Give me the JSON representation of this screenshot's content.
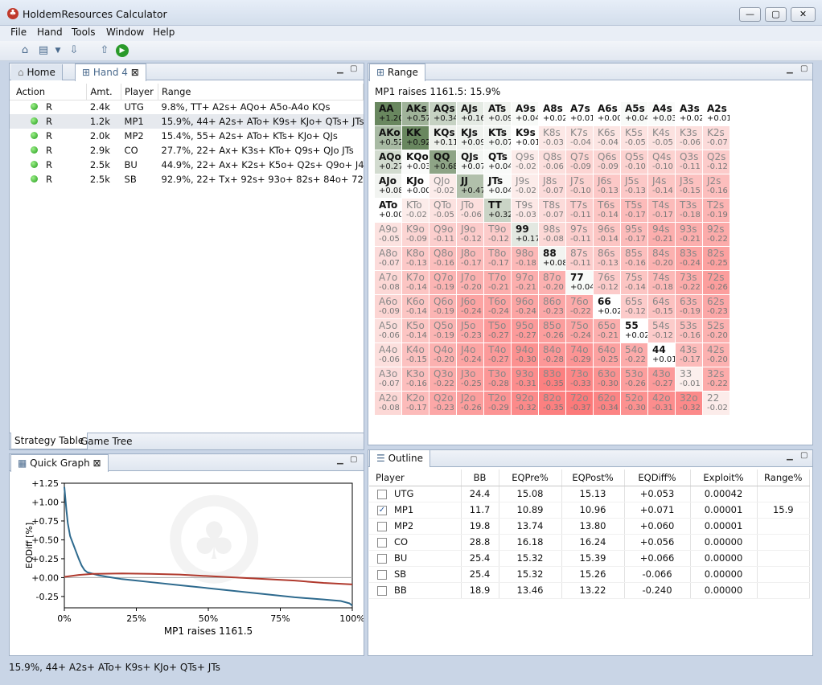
{
  "app": {
    "title": "HoldemResources Calculator",
    "min": "—",
    "max": "▢",
    "close": "✕"
  },
  "menu": [
    "File",
    "Hand",
    "Tools",
    "Window",
    "Help"
  ],
  "tabs": {
    "home": "Home",
    "hand": "Hand 4",
    "close": "⊠"
  },
  "strategy": {
    "headers": [
      "Action",
      "Amt.",
      "Player",
      "Range"
    ],
    "rows": [
      {
        "action": "R",
        "amt": "2.4k",
        "player": "UTG",
        "range": "9.8%, TT+ A2s+ AQo+ A5o-A4o KQs"
      },
      {
        "action": "R",
        "amt": "1.2k",
        "player": "MP1",
        "range": "15.9%, 44+ A2s+ ATo+ K9s+ KJo+ QTs+ JTs"
      },
      {
        "action": "R",
        "amt": "2.0k",
        "player": "MP2",
        "range": "15.4%, 55+ A2s+ ATo+ KTs+ KJo+ QJs"
      },
      {
        "action": "R",
        "amt": "2.9k",
        "player": "CO",
        "range": "27.7%, 22+ Ax+ K3s+ KTo+ Q9s+ QJo JTs"
      },
      {
        "action": "R",
        "amt": "2.5k",
        "player": "BU",
        "range": "44.9%, 22+ Ax+ K2s+ K5o+ Q2s+ Q9o+ J4s+ J9"
      },
      {
        "action": "R",
        "amt": "2.5k",
        "player": "SB",
        "range": "92.9%, 22+ Tx+ 92s+ 93o+ 82s+ 84o+ 72s+ 73o"
      }
    ],
    "bottom_tabs": [
      "Strategy Table",
      "Game Tree"
    ]
  },
  "quick_graph": {
    "tab": "Quick Graph",
    "close": "⊠"
  },
  "chart_data": {
    "type": "line",
    "xlabel": "MP1 raises 1161.5",
    "ylabel": "EQDiff [%]",
    "ylim": [
      -0.4,
      1.25
    ],
    "xlim": [
      0,
      100
    ],
    "yticks": [
      "+1.25",
      "+1.00",
      "+0.75",
      "+0.50",
      "+0.25",
      "+0.00",
      "-0.25"
    ],
    "yvals": [
      1.25,
      1.0,
      0.75,
      0.5,
      0.25,
      0.0,
      -0.25
    ],
    "xticks": [
      "0%",
      "25%",
      "50%",
      "75%",
      "100%"
    ],
    "xvals": [
      0,
      25,
      50,
      75,
      100
    ],
    "series": [
      {
        "color": "#2e6a8e",
        "points": [
          [
            0,
            1.2
          ],
          [
            0.7,
            0.9
          ],
          [
            1.2,
            0.72
          ],
          [
            2,
            0.55
          ],
          [
            3,
            0.45
          ],
          [
            4,
            0.35
          ],
          [
            5,
            0.25
          ],
          [
            6,
            0.16
          ],
          [
            7,
            0.1
          ],
          [
            8,
            0.07
          ],
          [
            10,
            0.05
          ],
          [
            12,
            0.03
          ],
          [
            15,
            0.01
          ],
          [
            20,
            -0.02
          ],
          [
            25,
            -0.04
          ],
          [
            30,
            -0.06
          ],
          [
            40,
            -0.1
          ],
          [
            50,
            -0.14
          ],
          [
            60,
            -0.18
          ],
          [
            70,
            -0.22
          ],
          [
            80,
            -0.26
          ],
          [
            90,
            -0.29
          ],
          [
            96,
            -0.31
          ],
          [
            99,
            -0.34
          ],
          [
            100,
            -0.37
          ]
        ]
      },
      {
        "color": "#b03a2e",
        "points": [
          [
            0,
            0.01
          ],
          [
            5,
            0.035
          ],
          [
            10,
            0.05
          ],
          [
            20,
            0.055
          ],
          [
            30,
            0.05
          ],
          [
            40,
            0.04
          ],
          [
            50,
            0.02
          ],
          [
            60,
            0.0
          ],
          [
            70,
            -0.02
          ],
          [
            80,
            -0.04
          ],
          [
            90,
            -0.07
          ],
          [
            100,
            -0.09
          ]
        ]
      }
    ]
  },
  "range": {
    "tab": "Range",
    "subtitle": "MP1 raises 1161.5: 15.9%",
    "cells": [
      [
        "AA",
        "+1.20",
        "AKs",
        "+0.57",
        "AQs",
        "+0.34",
        "AJs",
        "+0.16",
        "ATs",
        "+0.09",
        "A9s",
        "+0.04",
        "A8s",
        "+0.02",
        "A7s",
        "+0.01",
        "A6s",
        "+0.00",
        "A5s",
        "+0.04",
        "A4s",
        "+0.03",
        "A3s",
        "+0.02",
        "A2s",
        "+0.01"
      ],
      [
        "AKo",
        "+0.52",
        "KK",
        "+0.92",
        "KQs",
        "+0.11",
        "KJs",
        "+0.09",
        "KTs",
        "+0.07",
        "K9s",
        "+0.01",
        "K8s",
        "-0.03",
        "K7s",
        "-0.04",
        "K6s",
        "-0.04",
        "K5s",
        "-0.05",
        "K4s",
        "-0.05",
        "K3s",
        "-0.06",
        "K2s",
        "-0.07"
      ],
      [
        "AQo",
        "+0.27",
        "KQo",
        "+0.03",
        "QQ",
        "+0.68",
        "QJs",
        "+0.07",
        "QTs",
        "+0.04",
        "Q9s",
        "-0.02",
        "Q8s",
        "-0.06",
        "Q7s",
        "-0.09",
        "Q6s",
        "-0.09",
        "Q5s",
        "-0.10",
        "Q4s",
        "-0.10",
        "Q3s",
        "-0.11",
        "Q2s",
        "-0.12"
      ],
      [
        "AJo",
        "+0.08",
        "KJo",
        "+0.00",
        "QJo",
        "-0.02",
        "JJ",
        "+0.47",
        "JTs",
        "+0.04",
        "J9s",
        "-0.02",
        "J8s",
        "-0.07",
        "J7s",
        "-0.10",
        "J6s",
        "-0.13",
        "J5s",
        "-0.13",
        "J4s",
        "-0.14",
        "J3s",
        "-0.15",
        "J2s",
        "-0.16"
      ],
      [
        "ATo",
        "+0.00",
        "KTo",
        "-0.02",
        "QTo",
        "-0.05",
        "JTo",
        "-0.06",
        "TT",
        "+0.32",
        "T9s",
        "-0.03",
        "T8s",
        "-0.07",
        "T7s",
        "-0.11",
        "T6s",
        "-0.14",
        "T5s",
        "-0.17",
        "T4s",
        "-0.17",
        "T3s",
        "-0.18",
        "T2s",
        "-0.19"
      ],
      [
        "A9o",
        "-0.05",
        "K9o",
        "-0.09",
        "Q9o",
        "-0.11",
        "J9o",
        "-0.12",
        "T9o",
        "-0.12",
        "99",
        "+0.17",
        "98s",
        "-0.08",
        "97s",
        "-0.11",
        "96s",
        "-0.14",
        "95s",
        "-0.17",
        "94s",
        "-0.21",
        "93s",
        "-0.21",
        "92s",
        "-0.22"
      ],
      [
        "A8o",
        "-0.07",
        "K8o",
        "-0.13",
        "Q8o",
        "-0.16",
        "J8o",
        "-0.17",
        "T8o",
        "-0.17",
        "98o",
        "-0.18",
        "88",
        "+0.08",
        "87s",
        "-0.11",
        "86s",
        "-0.13",
        "85s",
        "-0.16",
        "84s",
        "-0.20",
        "83s",
        "-0.24",
        "82s",
        "-0.25"
      ],
      [
        "A7o",
        "-0.08",
        "K7o",
        "-0.14",
        "Q7o",
        "-0.19",
        "J7o",
        "-0.20",
        "T7o",
        "-0.21",
        "97o",
        "-0.21",
        "87o",
        "-0.20",
        "77",
        "+0.04",
        "76s",
        "-0.12",
        "75s",
        "-0.14",
        "74s",
        "-0.18",
        "73s",
        "-0.22",
        "72s",
        "-0.26"
      ],
      [
        "A6o",
        "-0.09",
        "K6o",
        "-0.14",
        "Q6o",
        "-0.19",
        "J6o",
        "-0.24",
        "T6o",
        "-0.24",
        "96o",
        "-0.24",
        "86o",
        "-0.23",
        "76o",
        "-0.22",
        "66",
        "+0.02",
        "65s",
        "-0.12",
        "64s",
        "-0.15",
        "63s",
        "-0.19",
        "62s",
        "-0.23"
      ],
      [
        "A5o",
        "-0.06",
        "K5o",
        "-0.14",
        "Q5o",
        "-0.19",
        "J5o",
        "-0.23",
        "T5o",
        "-0.27",
        "95o",
        "-0.27",
        "85o",
        "-0.26",
        "75o",
        "-0.24",
        "65o",
        "-0.21",
        "55",
        "+0.02",
        "54s",
        "-0.12",
        "53s",
        "-0.16",
        "52s",
        "-0.20"
      ],
      [
        "A4o",
        "-0.06",
        "K4o",
        "-0.15",
        "Q4o",
        "-0.20",
        "J4o",
        "-0.24",
        "T4o",
        "-0.27",
        "94o",
        "-0.30",
        "84o",
        "-0.28",
        "74o",
        "-0.29",
        "64o",
        "-0.25",
        "54o",
        "-0.22",
        "44",
        "+0.01",
        "43s",
        "-0.17",
        "42s",
        "-0.20"
      ],
      [
        "A3o",
        "-0.07",
        "K3o",
        "-0.16",
        "Q3o",
        "-0.22",
        "J3o",
        "-0.25",
        "T3o",
        "-0.28",
        "93o",
        "-0.31",
        "83o",
        "-0.35",
        "73o",
        "-0.33",
        "63o",
        "-0.30",
        "53o",
        "-0.26",
        "43o",
        "-0.27",
        "33",
        "-0.01",
        "32s",
        "-0.22"
      ],
      [
        "A2o",
        "-0.08",
        "K2o",
        "-0.17",
        "Q2o",
        "-0.23",
        "J2o",
        "-0.26",
        "T2o",
        "-0.29",
        "92o",
        "-0.32",
        "82o",
        "-0.35",
        "72o",
        "-0.37",
        "62o",
        "-0.34",
        "52o",
        "-0.30",
        "42o",
        "-0.31",
        "32o",
        "-0.32",
        "22",
        "-0.02"
      ]
    ],
    "in_range": [
      "AA",
      "AKs",
      "AQs",
      "AJs",
      "ATs",
      "A9s",
      "A8s",
      "A7s",
      "A6s",
      "A5s",
      "A4s",
      "A3s",
      "A2s",
      "AKo",
      "KK",
      "KQs",
      "KJs",
      "KTs",
      "K9s",
      "AQo",
      "KQo",
      "QQ",
      "QJs",
      "QTs",
      "AJo",
      "KJo",
      "JJ",
      "JTs",
      "ATo",
      "TT",
      "99",
      "88",
      "77",
      "66",
      "55",
      "44"
    ]
  },
  "outline": {
    "tab": "Outline",
    "headers": [
      "Player",
      "BB",
      "EQPre%",
      "EQPost%",
      "EQDiff%",
      "Exploit%",
      "Range%"
    ],
    "rows": [
      {
        "player": "UTG",
        "checked": false,
        "bb": "24.4",
        "pre": "15.08",
        "post": "15.13",
        "diff": "+0.053",
        "exploit": "0.00042",
        "range": ""
      },
      {
        "player": "MP1",
        "checked": true,
        "bb": "11.7",
        "pre": "10.89",
        "post": "10.96",
        "diff": "+0.071",
        "exploit": "0.00001",
        "range": "15.9"
      },
      {
        "player": "MP2",
        "checked": false,
        "bb": "19.8",
        "pre": "13.74",
        "post": "13.80",
        "diff": "+0.060",
        "exploit": "0.00001",
        "range": ""
      },
      {
        "player": "CO",
        "checked": false,
        "bb": "28.8",
        "pre": "16.18",
        "post": "16.24",
        "diff": "+0.056",
        "exploit": "0.00000",
        "range": ""
      },
      {
        "player": "BU",
        "checked": false,
        "bb": "25.4",
        "pre": "15.32",
        "post": "15.39",
        "diff": "+0.066",
        "exploit": "0.00000",
        "range": ""
      },
      {
        "player": "SB",
        "checked": false,
        "bb": "25.4",
        "pre": "15.32",
        "post": "15.26",
        "diff": "-0.066",
        "exploit": "0.00000",
        "range": ""
      },
      {
        "player": "BB",
        "checked": false,
        "bb": "18.9",
        "pre": "13.46",
        "post": "13.22",
        "diff": "-0.240",
        "exploit": "0.00000",
        "range": ""
      }
    ]
  },
  "status": "15.9%, 44+ A2s+ ATo+ K9s+ KJo+ QTs+ JTs"
}
